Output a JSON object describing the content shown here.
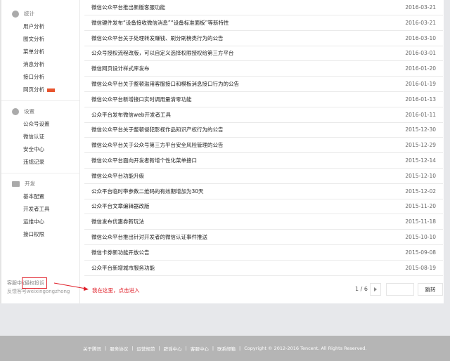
{
  "sidebar": {
    "groups": [
      {
        "title": "统计",
        "items": [
          "用户分析",
          "图文分析",
          "菜单分析",
          "消息分析",
          "接口分析",
          "网页分析"
        ]
      },
      {
        "title": "设置",
        "items": [
          "公众号设置",
          "微信认证",
          "安全中心",
          "违规记录"
        ]
      },
      {
        "title": "开发",
        "items": [
          "基本配置",
          "开发者工具",
          "运维中心",
          "接口权限"
        ]
      }
    ],
    "bottom": {
      "service": "客服中心",
      "complaint": "侵权投诉",
      "feedback": "反馈客号weixingongzhong"
    }
  },
  "notices": [
    {
      "title": "微信公众平台推出新版客服功能",
      "date": "2016-03-21"
    },
    {
      "title": "微信硬件发布“设备接收微信消息”“设备标准面板”等新特性",
      "date": "2016-03-21"
    },
    {
      "title": "微信公众平台关于处理转发赚钱、刷分刷榜类行为的公告",
      "date": "2016-03-10"
    },
    {
      "title": "公众号授权流程改版，可以自定义选择权限授权给第三方平台",
      "date": "2016-03-01"
    },
    {
      "title": "微信网页设计样式库发布",
      "date": "2016-01-20"
    },
    {
      "title": "微信公众平台关于整顿滥用客服接口和模板消息接口行为的公告",
      "date": "2016-01-19"
    },
    {
      "title": "微信公众平台新增接口实时调用量清零功能",
      "date": "2016-01-13"
    },
    {
      "title": "公众平台发布微信web开发者工具",
      "date": "2016-01-11"
    },
    {
      "title": "微信公众平台关于整顿侵犯影视作品知识产权行为的公告",
      "date": "2015-12-30"
    },
    {
      "title": "微信公众平台关于公众号第三方平台安全风险管理的公告",
      "date": "2015-12-29"
    },
    {
      "title": "微信公众平台面向开发者新增个性化菜单接口",
      "date": "2015-12-14"
    },
    {
      "title": "微信公众平台功能升级",
      "date": "2015-12-10"
    },
    {
      "title": "公众平台临时带参数二维码的有效期增加为30天",
      "date": "2015-12-02"
    },
    {
      "title": "公众平台文章编辑器改版",
      "date": "2015-11-20"
    },
    {
      "title": "微信发布优惠券新玩法",
      "date": "2015-11-18"
    },
    {
      "title": "微信公众平台推出针对开发者的微信认证事件推送",
      "date": "2015-10-10"
    },
    {
      "title": "微信卡券新功能开放公告",
      "date": "2015-09-08"
    },
    {
      "title": "公众平台新增城市服务功能",
      "date": "2015-08-19"
    }
  ],
  "annotation": "我在这里，点击进入",
  "pagination": {
    "current": "1 / 6",
    "jump_value": "",
    "jump_label": "跳转"
  },
  "footer": {
    "links": [
      "关于腾讯",
      "服务协议",
      "运营规范",
      "辟谣中心",
      "客服中心",
      "联系邮箱"
    ],
    "copyright": "Copyright © 2012-2016 Tencent. All Rights Reserved."
  },
  "colors": {
    "annotation": "#e0202a",
    "new_badge": "#e8542e"
  }
}
